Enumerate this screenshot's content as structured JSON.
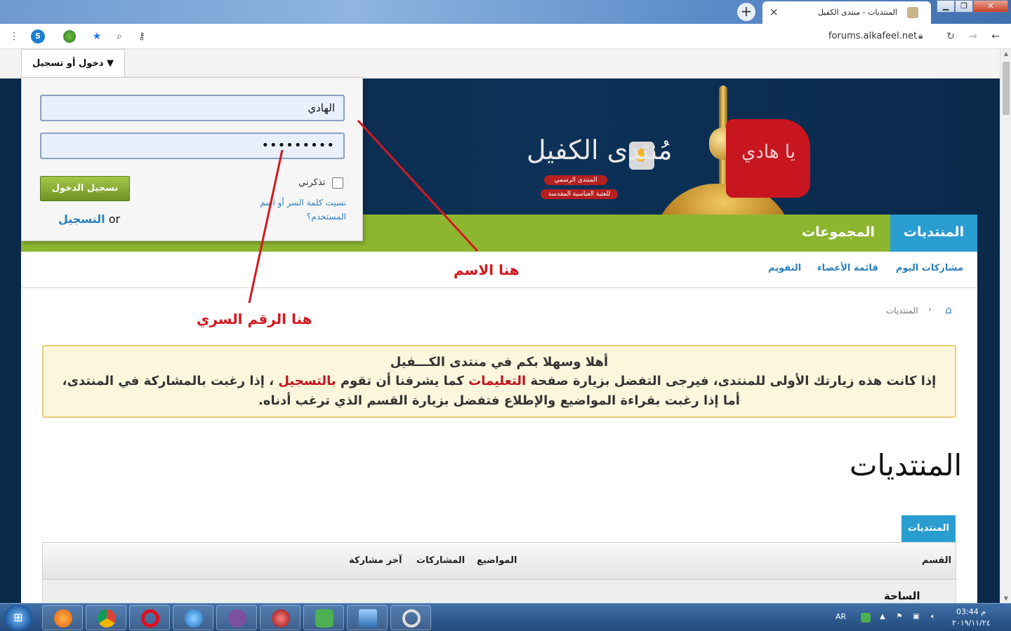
{
  "browser": {
    "tab_title": "المنتديات - منتدى الكفيل",
    "tab_close": "×",
    "new_tab": "+",
    "url": "forums.alkafeel.net",
    "window_controls": {
      "minimize": "▁",
      "maximize": "❐",
      "close": "✕"
    },
    "toolbar_icons": [
      "forward-icon",
      "back-icon",
      "reload-icon",
      "lock-icon",
      "key-icon",
      "zoom-icon",
      "star-icon",
      "extension-globe-icon",
      "extension-s-icon",
      "menu-icon"
    ]
  },
  "topstrip": {
    "login_toggle": "▼ دخول أو تسجيل"
  },
  "login": {
    "username_value": "الهادي",
    "password_value": "•••••••••",
    "remember_label": "تذكرني",
    "forgot_label": "نسيت كلمة السر أو اسم المستخدم؟",
    "login_button": "تسجيل الدخول",
    "register_prefix": "or",
    "register_link": "التسجيل"
  },
  "banner": {
    "logo_text": "مُنتدى الكفيل",
    "sub1": "المنتدى الرسمي",
    "sub2": "للعتبة العباسية المقدسة",
    "flag_text": "يا هادي"
  },
  "nav": {
    "tabs": [
      {
        "label": "المنتديات",
        "active": true
      },
      {
        "label": "المجموعات",
        "active": false
      }
    ],
    "subnav": [
      {
        "label": "مشاركات اليوم"
      },
      {
        "label": "قائمة الأعضاء"
      },
      {
        "label": "التقويم"
      }
    ]
  },
  "breadcrumb": {
    "separator": "›",
    "current": "المنتديات"
  },
  "notice": {
    "title": "أهلا وسهلا بكم في منتدى الكـــفيل",
    "line1_part1": "إذا كانت هذه زيارتك الأولى للمنتدى، فيرجى التفضل بزيارة صفحة ",
    "line1_link1": "التعليمات",
    "line1_part2": " كما يشرفنا أن تقوم ",
    "line1_link2": "بالتسجيل",
    "line1_part3": " ، إذا رغبت بالمشاركة في المنتدى، أما إذا رغبت بقراءة المواضيع والإطلاع فتفضل بزيارة القسم الذي ترغب أدناه."
  },
  "forums": {
    "heading": "المنتديات",
    "tab_label": "المنتديات",
    "columns": [
      "القسم",
      "المواضيع",
      "المشاركات",
      "آخر مشاركة"
    ],
    "rows": [
      {
        "title": "الساحة الاسلامية"
      }
    ]
  },
  "annotations": {
    "name_label": "هنا الاسم",
    "password_label": "هنا الرقم السري",
    "color": "#d11920"
  },
  "taskbar": {
    "apps": [
      "firefox-icon",
      "chrome-icon",
      "opera-icon",
      "ie-icon",
      "viber-icon",
      "media-icon",
      "wifi-app-icon",
      "photo-icon",
      "search-tool-icon"
    ],
    "language": "AR",
    "time": "03:44 م",
    "date": "٢٠١٩/١١/٢٤"
  },
  "colors": {
    "nav_green": "#8db630",
    "nav_blue": "#2a9dd0",
    "banner_navy": "#0b2a4a",
    "notice_bg": "#fbf6dc",
    "link_blue": "#2a7fc0"
  }
}
